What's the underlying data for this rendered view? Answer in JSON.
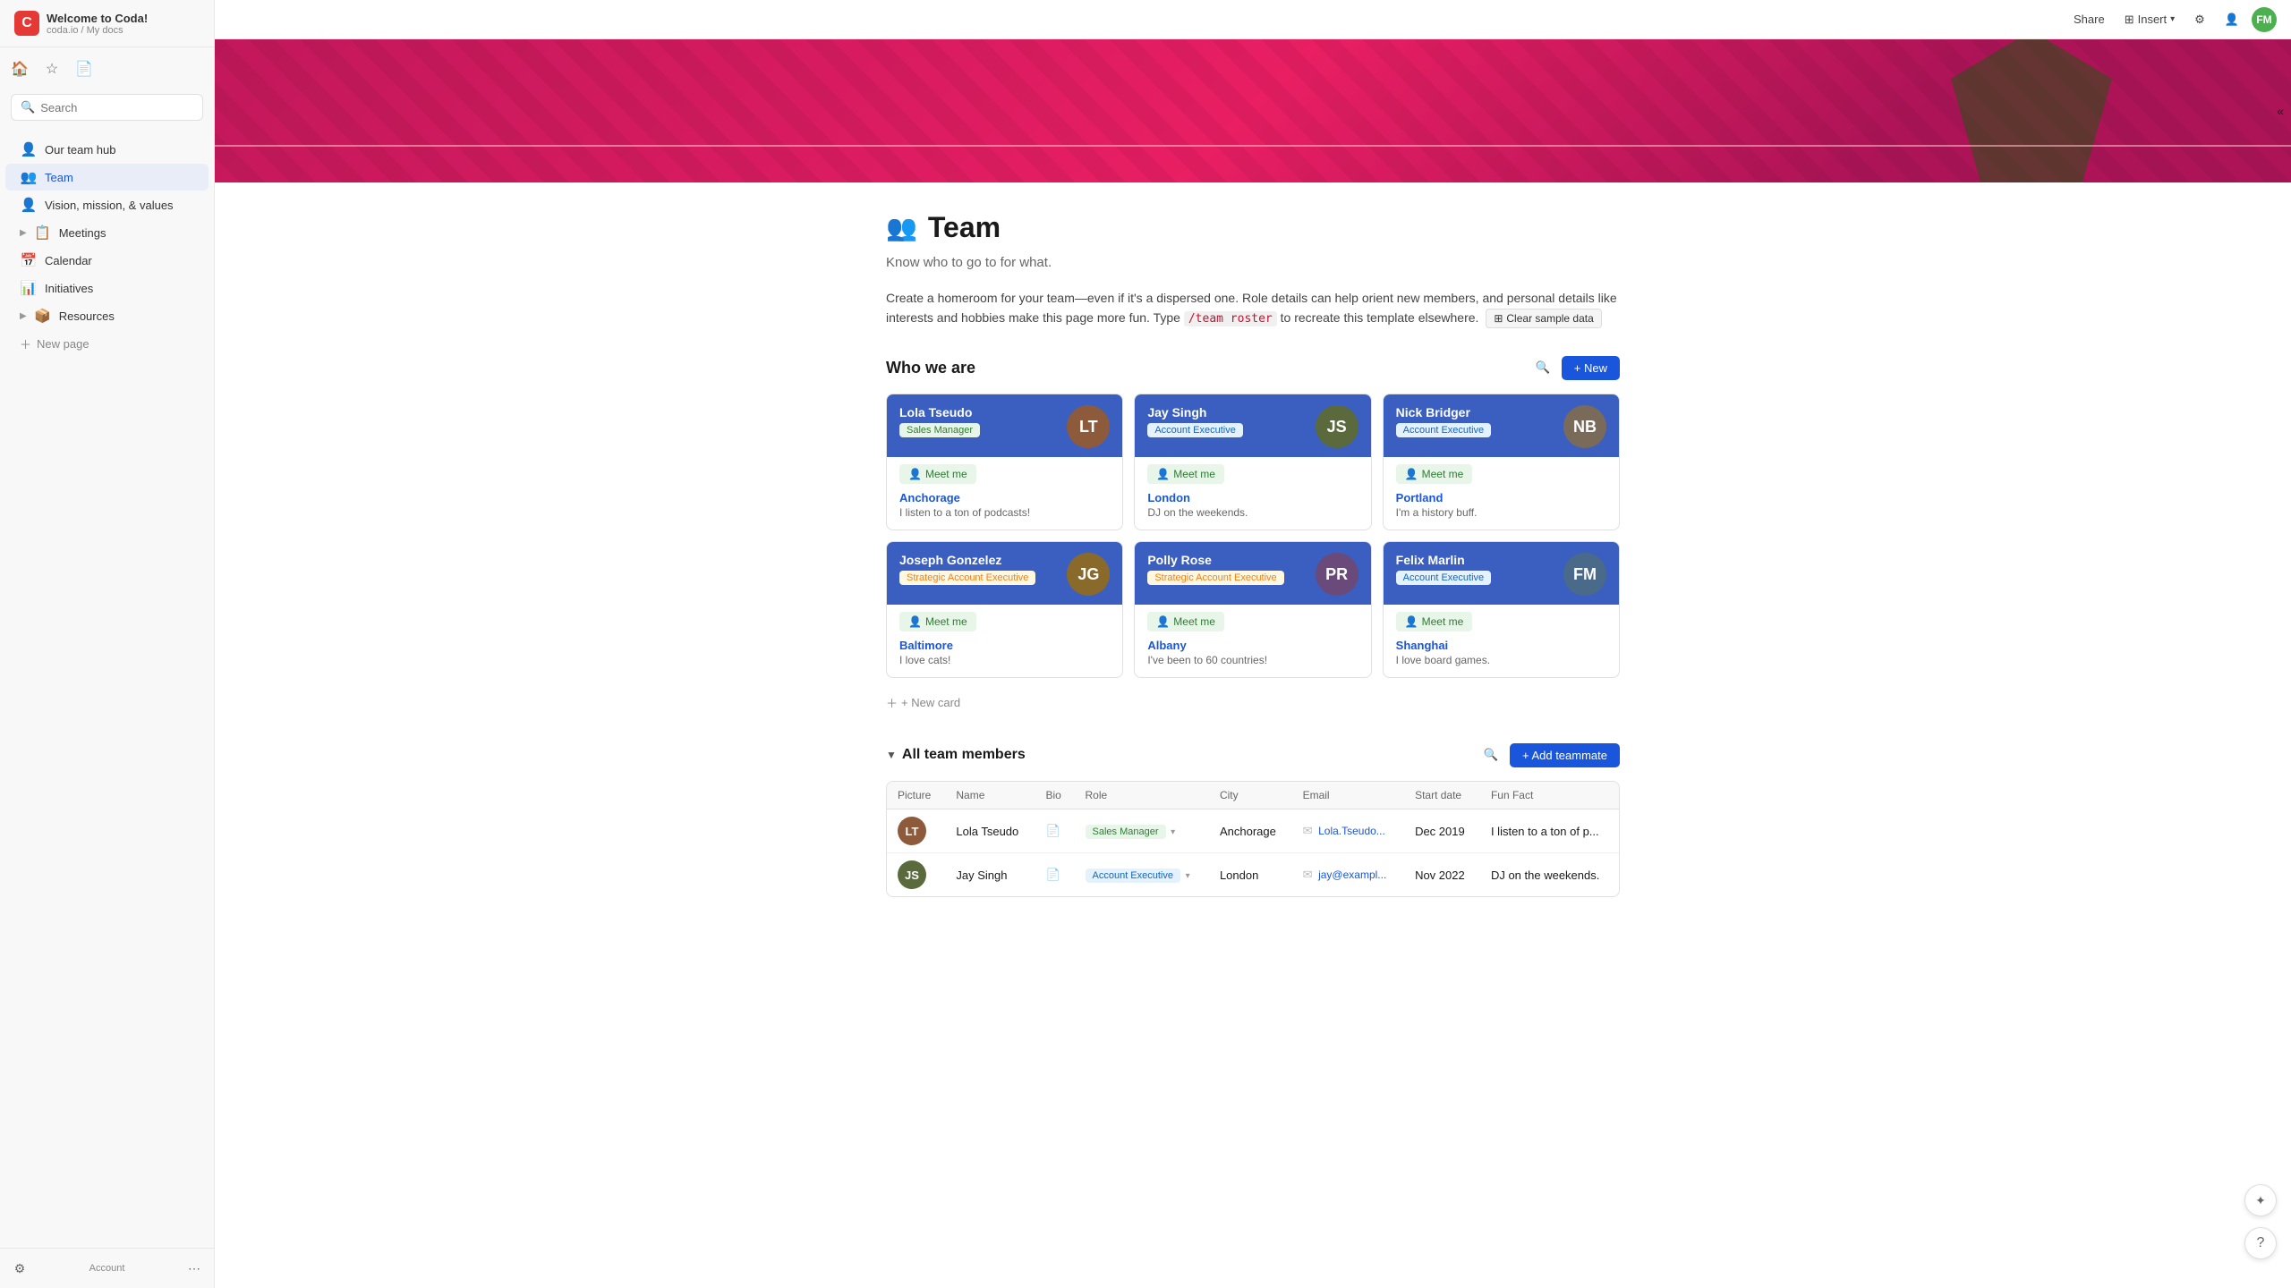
{
  "app": {
    "title": "Welcome to Coda!",
    "breadcrumb": "coda.io / My docs",
    "logo_letter": "C"
  },
  "topbar": {
    "share_label": "Share",
    "insert_label": "Insert",
    "user_avatar_initials": "FM"
  },
  "sidebar": {
    "search_placeholder": "Search",
    "nav_items": [
      {
        "id": "our-team-hub",
        "label": "Our team hub",
        "icon": "👤",
        "active": false
      },
      {
        "id": "team",
        "label": "Team",
        "icon": "👥",
        "active": true
      },
      {
        "id": "vision",
        "label": "Vision, mission, & values",
        "icon": "👤",
        "active": false
      },
      {
        "id": "meetings",
        "label": "Meetings",
        "icon": "📋",
        "active": false,
        "has_chevron": true
      },
      {
        "id": "calendar",
        "label": "Calendar",
        "icon": "📅",
        "active": false
      },
      {
        "id": "initiatives",
        "label": "Initiatives",
        "icon": "📊",
        "active": false
      },
      {
        "id": "resources",
        "label": "Resources",
        "icon": "📦",
        "active": false,
        "has_chevron": true
      }
    ],
    "new_page_label": "New page"
  },
  "page": {
    "title": "Team",
    "emoji": "👥",
    "subtitle": "Know who to go to for what.",
    "description": "Create a homeroom for your team—even if it's a dispersed one. Role details can help orient new members, and personal details like interests and hobbies make this page more fun. Type",
    "code_snippet": "/team roster",
    "description_suffix": "to recreate this template elsewhere.",
    "clear_btn_label": "Clear sample data"
  },
  "who_we_are": {
    "section_title": "Who we are",
    "new_btn_label": "+ New",
    "new_card_label": "+ New card",
    "cards": [
      {
        "id": "lola",
        "name": "Lola Tseudo",
        "role": "Sales Manager",
        "role_class": "role-sales",
        "city": "Anchorage",
        "fact": "I listen to a ton of podcasts!",
        "header_color": "#3b5fc0",
        "avatar_color": "#8d5a3c",
        "avatar_initials": "LT",
        "meet_label": "Meet me"
      },
      {
        "id": "jay",
        "name": "Jay Singh",
        "role": "Account Executive",
        "role_class": "role-account",
        "city": "London",
        "fact": "DJ on the weekends.",
        "header_color": "#3b5fc0",
        "avatar_color": "#5a6a3c",
        "avatar_initials": "JS",
        "meet_label": "Meet me"
      },
      {
        "id": "nick",
        "name": "Nick Bridger",
        "role": "Account Executive",
        "role_class": "role-account",
        "city": "Portland",
        "fact": "I'm a history buff.",
        "header_color": "#3b5fc0",
        "avatar_color": "#7a6a5a",
        "avatar_initials": "NB",
        "meet_label": "Meet me"
      },
      {
        "id": "joseph",
        "name": "Joseph Gonzelez",
        "role": "Strategic Account Executive",
        "role_class": "role-strategic",
        "city": "Baltimore",
        "fact": "I love cats!",
        "header_color": "#3b5fc0",
        "avatar_color": "#8a6a2a",
        "avatar_initials": "JG",
        "meet_label": "Meet me"
      },
      {
        "id": "polly",
        "name": "Polly Rose",
        "role": "Strategic Account Executive",
        "role_class": "role-strategic",
        "city": "Albany",
        "fact": "I've been to 60 countries!",
        "header_color": "#3b5fc0",
        "avatar_color": "#6a4a7a",
        "avatar_initials": "PR",
        "meet_label": "Meet me"
      },
      {
        "id": "felix",
        "name": "Felix Marlin",
        "role": "Account Executive",
        "role_class": "role-account",
        "city": "Shanghai",
        "fact": "I love board games.",
        "header_color": "#3b5fc0",
        "avatar_color": "#4a6a8a",
        "avatar_initials": "FM",
        "meet_label": "Meet me"
      }
    ]
  },
  "all_team_members": {
    "section_title": "All team members",
    "add_btn_label": "+ Add teammate",
    "columns": [
      "Picture",
      "Name",
      "Bio",
      "Role",
      "City",
      "Email",
      "Start date",
      "Fun Fact"
    ],
    "rows": [
      {
        "name": "Lola Tseudo",
        "avatar_color": "#8d5a3c",
        "avatar_initials": "LT",
        "role": "Sales Manager",
        "role_class": "role-sales",
        "city": "Anchorage",
        "email": "Lola.Tseudo...",
        "start_date": "Dec 2019",
        "fun_fact": "I listen to a ton of p..."
      },
      {
        "name": "Jay Singh",
        "avatar_color": "#5a6a3c",
        "avatar_initials": "JS",
        "role": "Account Executive",
        "role_class": "role-account",
        "city": "London",
        "email": "jay@exampl...",
        "start_date": "Nov 2022",
        "fun_fact": "DJ on the weekends."
      }
    ]
  },
  "footer": {
    "account_label": "Account"
  }
}
